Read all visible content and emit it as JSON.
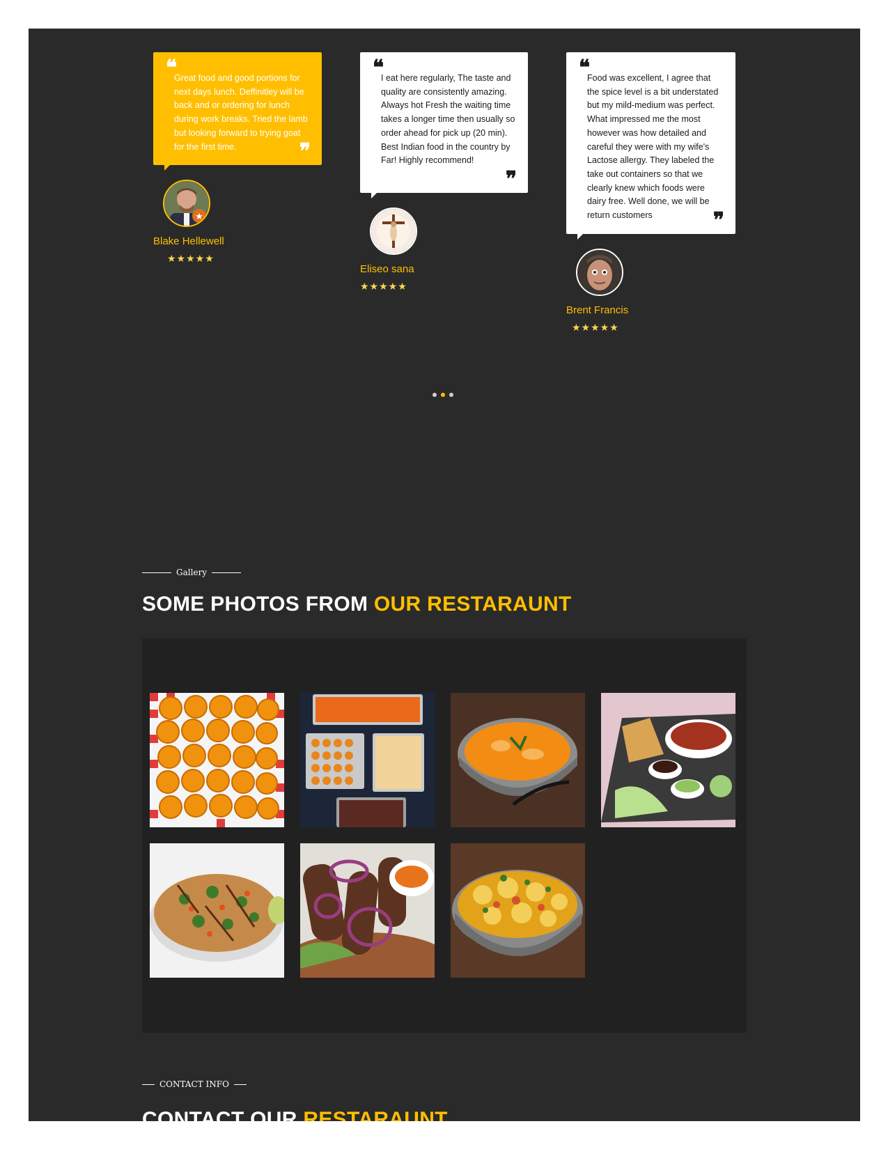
{
  "testimonials": [
    {
      "text": "Great food and good portions for next days lunch. Deffinitley will be back and or ordering for lunch during work breaks. Tried the lamb but looking forward to trying goat for the first time.",
      "name": "Blake Hellewell",
      "stars": "★★★★★"
    },
    {
      "text": "I eat here regularly, The taste and quality are consistently amazing. Always hot Fresh the waiting time takes a longer time then usually so order ahead for pick up (20 min). Best Indian food in the country by Far! Highly recommend!",
      "name": "Eliseo sana",
      "stars": "★★★★★"
    },
    {
      "text": "Food was excellent, I agree that the spice level is a bit understated but my mild-medium was perfect. What impressed me the most however was how detailed and careful they were with my wife's Lactose allergy. They labeled the take out containers so that we clearly knew which foods were dairy free. Well done, we will be return customers",
      "name": "Brent Francis",
      "stars": "★★★★★"
    }
  ],
  "quote_open": "❝",
  "quote_close": "❞",
  "gallery_section": {
    "kicker": "Gallery",
    "heading_white": "SOME PHOTOS FROM",
    "heading_accent": "OUR RESTARAUNT"
  },
  "contact_section": {
    "kicker": "CONTACT INFO",
    "heading_white": "CONTACT OUR",
    "heading_accent": "RESTARAUNT"
  },
  "colors": {
    "accent": "#ffbf00",
    "background": "#2a2a2a",
    "gallery_bg": "#212121"
  },
  "icons": {
    "quote_open": "quote-open-icon",
    "quote_close": "quote-close-icon",
    "star": "star-icon"
  }
}
